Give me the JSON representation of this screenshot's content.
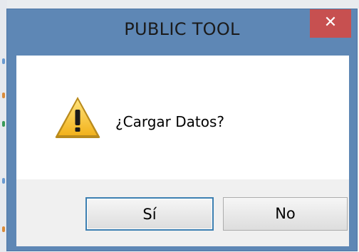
{
  "dialog": {
    "title": "PUBLIC TOOL",
    "close_label": "✕",
    "message": "¿Cargar Datos?",
    "icon": "warning-icon",
    "buttons": {
      "yes_label": "Sí",
      "no_label": "No"
    }
  },
  "colors": {
    "titlebar": "#5e87b5",
    "close_button": "#c75050",
    "default_button_border": "#3c7fb1"
  }
}
